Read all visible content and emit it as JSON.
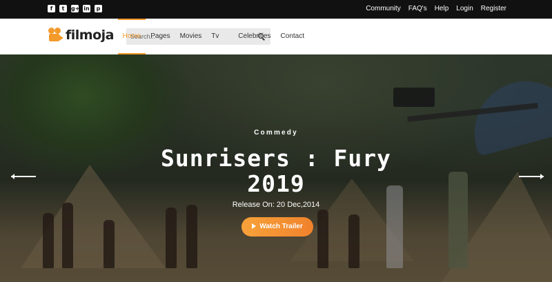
{
  "topbar": {
    "social": [
      {
        "icon": "facebook-icon",
        "glyph": "f"
      },
      {
        "icon": "twitter-icon",
        "glyph": "t"
      },
      {
        "icon": "google-plus-icon",
        "glyph": "g+"
      },
      {
        "icon": "linkedin-icon",
        "glyph": "in"
      },
      {
        "icon": "pinterest-icon",
        "glyph": "p"
      }
    ],
    "links": [
      "Community",
      "FAQ's",
      "Help",
      "Login",
      "Register"
    ]
  },
  "header": {
    "logo_text": "filmoja",
    "search": {
      "placeholder": "Search..."
    },
    "nav": [
      "Home",
      "Pages",
      "Movies",
      "Tv Show",
      "Celebrities",
      "Contact"
    ],
    "active_nav": "Home"
  },
  "hero": {
    "genre": "Commedy",
    "title_line1": "Sunrisers : Fury",
    "title_line2": "2019",
    "release": "Release On: 20 Dec,2014",
    "trailer_label": "Watch Trailer"
  },
  "colors": {
    "accent": "#f39a2b",
    "topbar_bg": "#111111"
  }
}
